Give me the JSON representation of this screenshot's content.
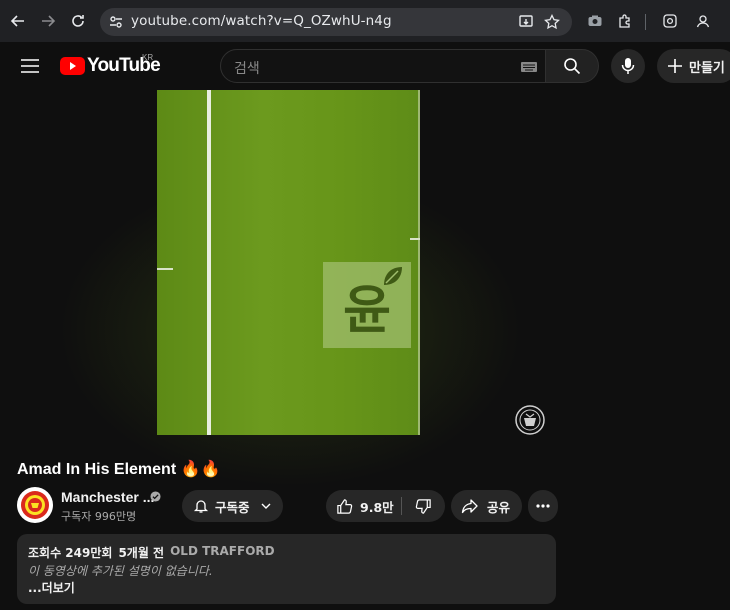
{
  "browser": {
    "url": "youtube.com/watch?v=Q_OZwhU-n4g",
    "nav_icons": [
      "back-arrow-icon",
      "forward-arrow-icon",
      "reload-icon"
    ],
    "extension_icons": [
      "camera-icon",
      "puzzle-icon",
      "screenshot-icon",
      "profile-icon"
    ]
  },
  "header": {
    "logo_text": "YouTube",
    "logo_region": "KR",
    "search_placeholder": "검색",
    "create_label": "만들기",
    "brand_color": "#ff0000"
  },
  "video": {
    "title": "Amad In His Element 🔥🔥",
    "watermark_char": "윤"
  },
  "channel": {
    "name": "Manchester ...",
    "subscribers": "구독자 996만명",
    "subscribe_label": "구독중"
  },
  "actions": {
    "likes": "9.8만",
    "share_label": "공유"
  },
  "description": {
    "views": "조회수 249만회",
    "age": "5개월 전",
    "location": "OLD TRAFFORD",
    "text": "이 동영상에 추가된 설명이 없습니다.",
    "more_label": "...더보기"
  }
}
